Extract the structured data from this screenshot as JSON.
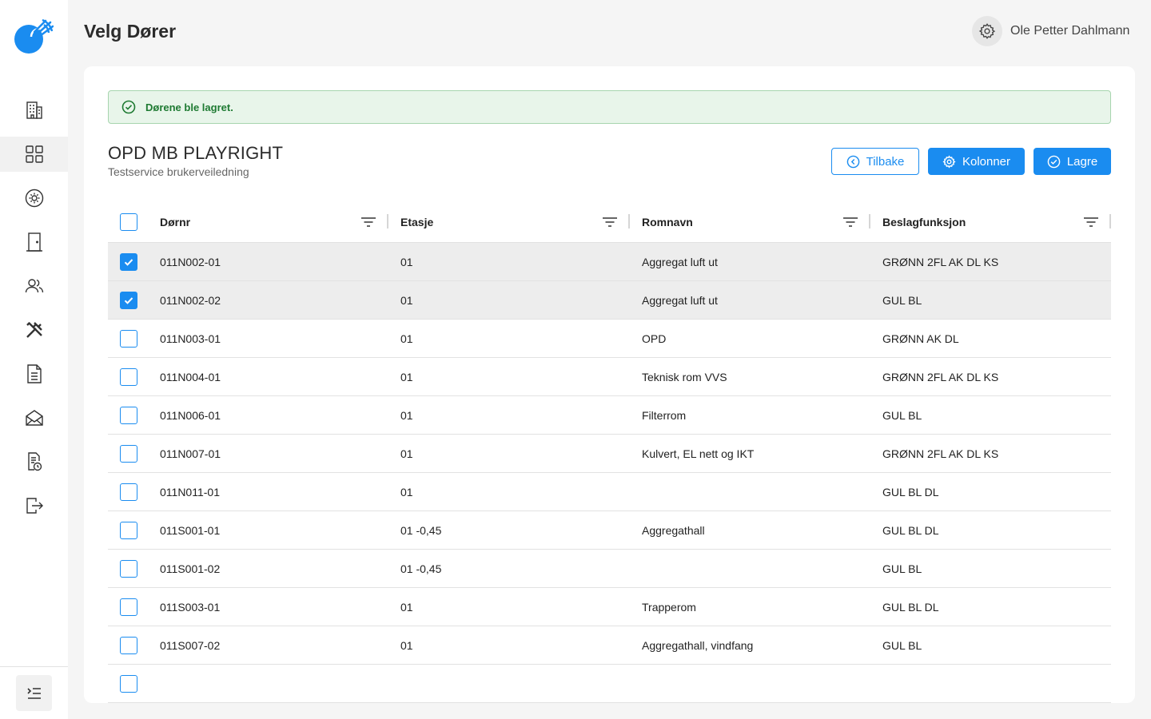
{
  "header": {
    "page_title": "Velg Dører",
    "user_name": "Ole Petter Dahlmann"
  },
  "sidebar": {
    "items": [
      {
        "icon": "building-icon",
        "active": false
      },
      {
        "icon": "grid-icon",
        "active": true
      },
      {
        "icon": "gear-circle-icon",
        "active": false
      },
      {
        "icon": "door-icon",
        "active": false
      },
      {
        "icon": "users-icon",
        "active": false
      },
      {
        "icon": "tools-icon",
        "active": false
      },
      {
        "icon": "document-icon",
        "active": false
      },
      {
        "icon": "envelope-icon",
        "active": false
      },
      {
        "icon": "document-clock-icon",
        "active": false
      },
      {
        "icon": "logout-icon",
        "active": false
      }
    ],
    "collapse_icon": "menu-collapse-icon"
  },
  "alert": {
    "text": "Dørene ble lagret.",
    "color": "#1e7a32"
  },
  "project": {
    "title": "OPD MB PLAYRIGHT",
    "subtitle": "Testservice brukerveiledning"
  },
  "buttons": {
    "back": "Tilbake",
    "columns": "Kolonner",
    "save": "Lagre"
  },
  "accent_color": "#1a8cf0",
  "table": {
    "headers": {
      "door": "Dørnr",
      "floor": "Etasje",
      "room": "Romnavn",
      "function": "Beslagfunksjon"
    },
    "rows": [
      {
        "checked": true,
        "door": "011N002-01",
        "floor": "01",
        "room": "Aggregat luft ut",
        "function": "GRØNN 2FL AK DL KS"
      },
      {
        "checked": true,
        "door": "011N002-02",
        "floor": "01",
        "room": "Aggregat luft ut",
        "function": "GUL BL"
      },
      {
        "checked": false,
        "door": "011N003-01",
        "floor": "01",
        "room": "OPD",
        "function": "GRØNN AK DL"
      },
      {
        "checked": false,
        "door": "011N004-01",
        "floor": "01",
        "room": "Teknisk rom VVS",
        "function": "GRØNN 2FL AK DL KS"
      },
      {
        "checked": false,
        "door": "011N006-01",
        "floor": "01",
        "room": "Filterrom",
        "function": "GUL BL"
      },
      {
        "checked": false,
        "door": "011N007-01",
        "floor": "01",
        "room": "Kulvert, EL nett og IKT",
        "function": "GRØNN 2FL AK DL KS"
      },
      {
        "checked": false,
        "door": "011N011-01",
        "floor": "01",
        "room": "",
        "function": "GUL BL DL"
      },
      {
        "checked": false,
        "door": "011S001-01",
        "floor": "01 -0,45",
        "room": "Aggregathall",
        "function": "GUL BL DL"
      },
      {
        "checked": false,
        "door": "011S001-02",
        "floor": "01 -0,45",
        "room": "",
        "function": "GUL BL"
      },
      {
        "checked": false,
        "door": "011S003-01",
        "floor": "01",
        "room": "Trapperom",
        "function": "GUL BL DL"
      },
      {
        "checked": false,
        "door": "011S007-02",
        "floor": "01",
        "room": "Aggregathall, vindfang",
        "function": "GUL BL"
      },
      {
        "checked": false,
        "door": "",
        "floor": "",
        "room": "",
        "function": ""
      }
    ]
  }
}
